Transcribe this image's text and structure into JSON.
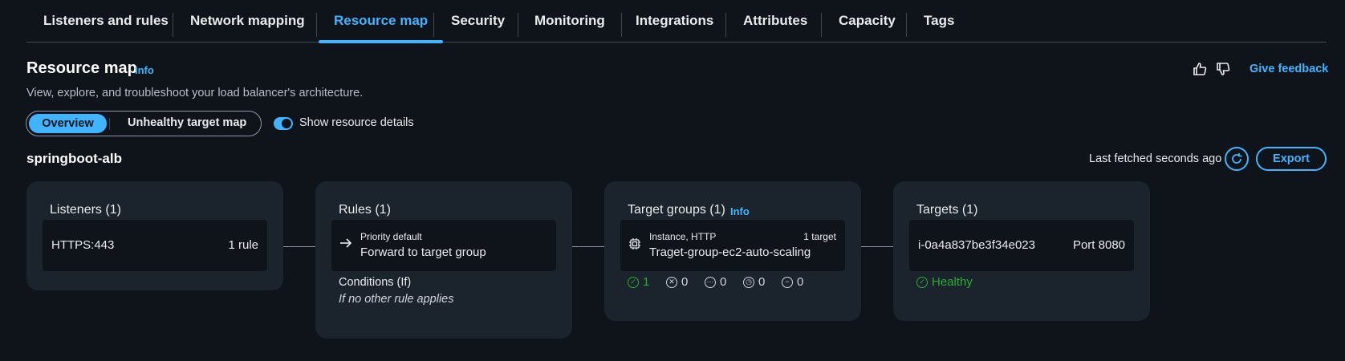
{
  "tabs": [
    {
      "label": "Listeners and rules",
      "active": false
    },
    {
      "label": "Network mapping",
      "active": false
    },
    {
      "label": "Resource map",
      "active": true
    },
    {
      "label": "Security",
      "active": false
    },
    {
      "label": "Monitoring",
      "active": false
    },
    {
      "label": "Integrations",
      "active": false
    },
    {
      "label": "Attributes",
      "active": false
    },
    {
      "label": "Capacity",
      "active": false
    },
    {
      "label": "Tags",
      "active": false
    }
  ],
  "header": {
    "title": "Resource map",
    "info": "Info",
    "description": "View, explore, and troubleshoot your load balancer's architecture.",
    "feedback": "Give feedback"
  },
  "toggle": {
    "overview": "Overview",
    "unhealthy": "Unhealthy target map",
    "show_details": "Show resource details",
    "show_details_on": true
  },
  "lb_name": "springboot-alb",
  "last_fetched": "Last fetched seconds ago",
  "export": "Export",
  "listeners": {
    "title": "Listeners (1)",
    "item": "HTTPS:443",
    "count": "1 rule"
  },
  "rules": {
    "title": "Rules (1)",
    "priority": "Priority default",
    "action": "Forward to target group",
    "conditions_label": "Conditions (If)",
    "conditions_value": "If no other rule applies"
  },
  "target_groups": {
    "title": "Target groups (1)",
    "info": "Info",
    "meta": "Instance, HTTP",
    "count": "1 target",
    "name": "Traget-group-ec2-auto-scaling",
    "status_counts": [
      "1",
      "0",
      "0",
      "0",
      "0"
    ]
  },
  "targets": {
    "title": "Targets (1)",
    "id": "i-0a4a837be3f34e023",
    "port": "Port 8080",
    "health": "Healthy"
  },
  "colors": {
    "accent": "#42b4ff",
    "healthy": "#29ad32",
    "card": "#1b232d",
    "background": "#0f141a"
  }
}
